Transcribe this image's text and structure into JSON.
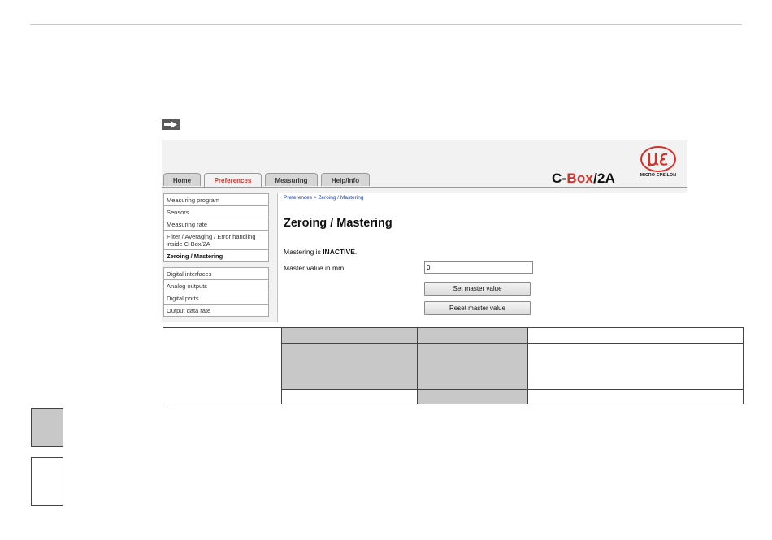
{
  "app": {
    "tabs": [
      "Home",
      "Preferences",
      "Measuring",
      "Help/Info"
    ],
    "active_tab": "Preferences",
    "brand": {
      "prefix": "C-",
      "accent": "Box",
      "suffix": "/2A"
    },
    "logo_text": "MICRO-EPSILON"
  },
  "sidebar": {
    "group1": [
      "Measuring program",
      "Sensors",
      "Measuring rate",
      "Filter / Averaging / Error handling inside C-Box/2A",
      "Zeroing / Mastering"
    ],
    "selected": "Zeroing / Mastering",
    "group2": [
      "Digital interfaces",
      "Analog outputs",
      "Digital ports",
      "Output data rate"
    ]
  },
  "content": {
    "breadcrumb": "Preferences > Zeroing / Mastering",
    "title": "Zeroing / Mastering",
    "status_prefix": "Mastering is ",
    "status_value": "INACTIVE",
    "status_suffix": ".",
    "master_label": "Master value in mm",
    "master_value": "0",
    "set_button": "Set master value",
    "reset_button": "Reset master value"
  },
  "colors": {
    "accent": "#d3302a",
    "link": "#1a3fbf",
    "shade": "#c8c8c8"
  }
}
